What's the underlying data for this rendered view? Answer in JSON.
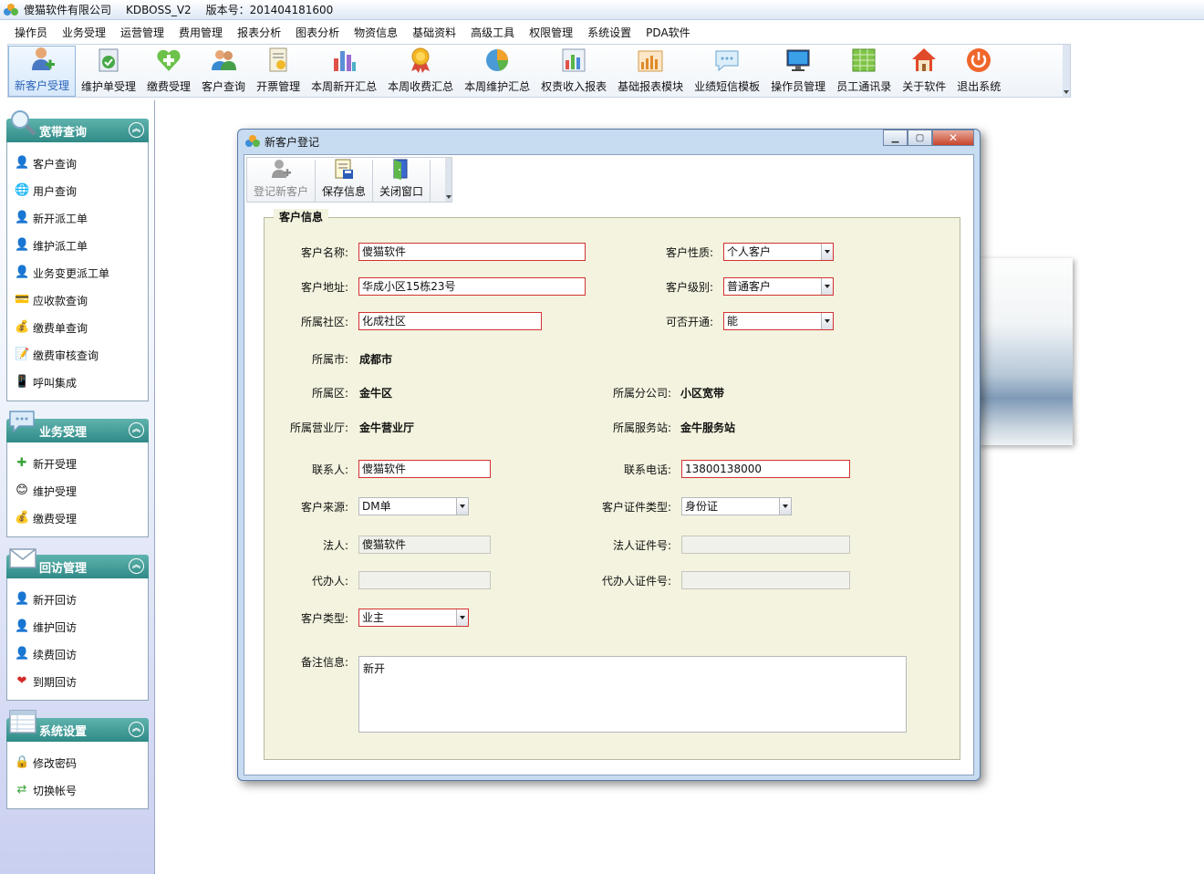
{
  "app": {
    "company": "傻猫软件有限公司",
    "product": "KDBOSS_V2",
    "version": "版本号：201404181600"
  },
  "menu": [
    "操作员",
    "业务受理",
    "运营管理",
    "费用管理",
    "报表分析",
    "图表分析",
    "物资信息",
    "基础资料",
    "高级工具",
    "权限管理",
    "系统设置",
    "PDA软件"
  ],
  "toolbar": [
    {
      "label": "新客户受理",
      "icon": "add-user-icon",
      "active": true
    },
    {
      "label": "维护单受理",
      "icon": "check-document-icon"
    },
    {
      "label": "缴费受理",
      "icon": "heart-plus-icon"
    },
    {
      "label": "客户查询",
      "icon": "users-icon"
    },
    {
      "label": "开票管理",
      "icon": "invoice-icon"
    },
    {
      "label": "本周新开汇总",
      "icon": "bar-chart-icon"
    },
    {
      "label": "本周收费汇总",
      "icon": "medal-icon"
    },
    {
      "label": "本周维护汇总",
      "icon": "pie-chart-icon"
    },
    {
      "label": "权责收入报表",
      "icon": "report-chart-icon"
    },
    {
      "label": "基础报表模块",
      "icon": "bar-report-icon"
    },
    {
      "label": "业绩短信模板",
      "icon": "message-icon"
    },
    {
      "label": "操作员管理",
      "icon": "monitor-icon"
    },
    {
      "label": "员工通讯录",
      "icon": "spreadsheet-icon"
    },
    {
      "label": "关于软件",
      "icon": "home-icon"
    },
    {
      "label": "退出系统",
      "icon": "power-icon"
    }
  ],
  "sidebar": [
    {
      "title": "宽带查询",
      "icon": "magnifier-icon",
      "items": [
        {
          "label": "客户查询",
          "icon": "user-icon"
        },
        {
          "label": "用户查询",
          "icon": "globe-icon"
        },
        {
          "label": "新开派工单",
          "icon": "user-icon"
        },
        {
          "label": "维护派工单",
          "icon": "user-icon"
        },
        {
          "label": "业务变更派工单",
          "icon": "user-icon"
        },
        {
          "label": "应收款查询",
          "icon": "card-icon"
        },
        {
          "label": "缴费单查询",
          "icon": "coins-icon"
        },
        {
          "label": "缴费审核查询",
          "icon": "edit-icon"
        },
        {
          "label": "呼叫集成",
          "icon": "phone-icon"
        }
      ]
    },
    {
      "title": "业务受理",
      "icon": "chat-icon",
      "items": [
        {
          "label": "新开受理",
          "icon": "plus-icon"
        },
        {
          "label": "维护受理",
          "icon": "smile-icon"
        },
        {
          "label": "缴费受理",
          "icon": "coins-icon"
        }
      ]
    },
    {
      "title": "回访管理",
      "icon": "envelope-icon",
      "items": [
        {
          "label": "新开回访",
          "icon": "user-icon"
        },
        {
          "label": "维护回访",
          "icon": "user-icon"
        },
        {
          "label": "续费回访",
          "icon": "user-icon"
        },
        {
          "label": "到期回访",
          "icon": "heart-icon"
        }
      ]
    },
    {
      "title": "系统设置",
      "icon": "table-icon",
      "items": [
        {
          "label": "修改密码",
          "icon": "lock-icon"
        },
        {
          "label": "切换帐号",
          "icon": "switch-icon"
        }
      ]
    }
  ],
  "dialog": {
    "title": "新客户登记",
    "toolbar": {
      "register": "登记新客户",
      "save": "保存信息",
      "close": "关闭窗口"
    },
    "legend": "客户信息",
    "fields": {
      "name": {
        "label": "客户名称:",
        "value": "傻猫软件"
      },
      "nature": {
        "label": "客户性质:",
        "value": "个人客户"
      },
      "address": {
        "label": "客户地址:",
        "value": "华成小区15栋23号"
      },
      "level": {
        "label": "客户级别:",
        "value": "普通客户"
      },
      "community": {
        "label": "所属社区:",
        "value": "化成社区"
      },
      "openable": {
        "label": "可否开通:",
        "value": "能"
      },
      "city": {
        "label": "所属市:",
        "value": "成都市"
      },
      "district": {
        "label": "所属区:",
        "value": "金牛区"
      },
      "branch": {
        "label": "所属分公司:",
        "value": "小区宽带"
      },
      "hall": {
        "label": "所属营业厅:",
        "value": "金牛营业厅"
      },
      "station": {
        "label": "所属服务站:",
        "value": "金牛服务站"
      },
      "contact": {
        "label": "联系人:",
        "value": "傻猫软件"
      },
      "phone": {
        "label": "联系电话:",
        "value": "13800138000"
      },
      "source": {
        "label": "客户来源:",
        "value": "DM单"
      },
      "id_type": {
        "label": "客户证件类型:",
        "value": "身份证"
      },
      "legal": {
        "label": "法人:",
        "value": "傻猫软件"
      },
      "legal_id": {
        "label": "法人证件号:",
        "value": ""
      },
      "agent": {
        "label": "代办人:",
        "value": ""
      },
      "agent_id": {
        "label": "代办人证件号:",
        "value": ""
      },
      "type": {
        "label": "客户类型:",
        "value": "业主"
      },
      "remark": {
        "label": "备注信息:",
        "value": "新开"
      }
    }
  }
}
